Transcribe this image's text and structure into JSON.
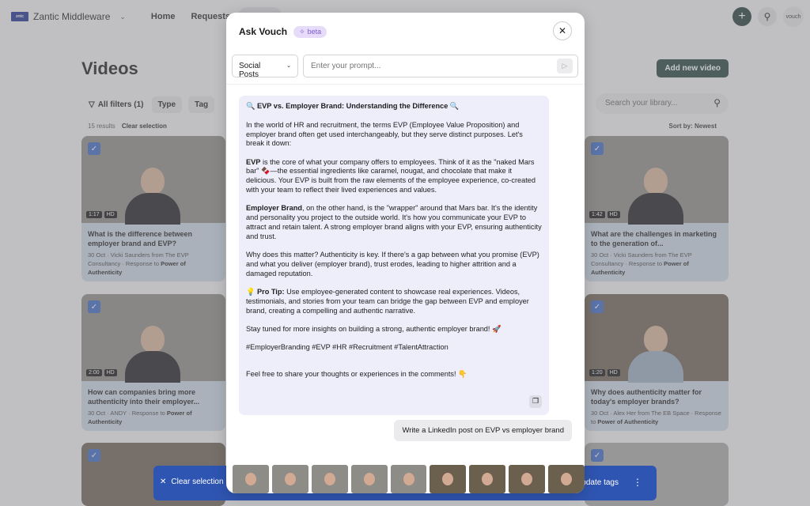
{
  "topbar": {
    "brand_logo_text": "zntc",
    "workspace": "Zantic Middleware",
    "nav": [
      "Home",
      "Requests",
      "Videos"
    ],
    "avatar_text": "vouch"
  },
  "page": {
    "title": "Videos",
    "add_button": "Add new video",
    "filters": {
      "all": "All filters (1)",
      "type": "Type",
      "tag": "Tag"
    },
    "search_placeholder": "Search your library...",
    "results": "15 results",
    "clear_selection": "Clear selection",
    "sort": "Sort by: Newest"
  },
  "cards": [
    {
      "duration": "1:17",
      "quality": "HD",
      "title": "What is the difference between employer brand and EVP?",
      "meta": "30 Oct · Vicki Saunders from The EVP Consultancy · Response to ",
      "response": "Power of Authenticity"
    },
    {
      "duration": "1:42",
      "quality": "HD",
      "title": "What are the challenges in marketing to the generation of...",
      "meta": "30 Oct · Vicki Saunders from The EVP Consultancy · Response to ",
      "response": "Power of Authenticity"
    },
    {
      "duration": "2:00",
      "quality": "HD",
      "title": "How can companies bring more authenticity into their employer...",
      "meta": "30 Oct · ANDY · Response to ",
      "response": "Power of Authenticity"
    },
    {
      "duration": "1:20",
      "quality": "HD",
      "title": "Why does authenticity matter for today's employer brands?",
      "meta": "30 Oct · Alex Her from The EB Space · Response to ",
      "response": "Power of Authenticity"
    }
  ],
  "bulk_bar": {
    "clear": "Clear selection",
    "tags": "Update tags"
  },
  "modal": {
    "title": "Ask Vouch",
    "badge": "beta",
    "type_select": "Social Posts",
    "prompt_placeholder": "Enter your prompt...",
    "response": {
      "heading": "🔍 EVP vs. Employer Brand: Understanding the Difference 🔍",
      "p1": "In the world of HR and recruitment, the terms EVP (Employee Value Proposition) and employer brand often get used interchangeably, but they serve distinct purposes. Let's break it down:",
      "p2_lead": "EVP",
      "p2": " is the core of what your company offers to employees. Think of it as the \"naked Mars bar\" 🍫—the essential ingredients like caramel, nougat, and chocolate that make it delicious. Your EVP is built from the raw elements of the employee experience, co-created with your team to reflect their lived experiences and values.",
      "p3_lead": "Employer Brand",
      "p3": ", on the other hand, is the \"wrapper\" around that Mars bar. It's the identity and personality you project to the outside world. It's how you communicate your EVP to attract and retain talent. A strong employer brand aligns with your EVP, ensuring authenticity and trust.",
      "p4": "Why does this matter? Authenticity is key. If there's a gap between what you promise (EVP) and what you deliver (employer brand), trust erodes, leading to higher attrition and a damaged reputation.",
      "p5_lead": "💡 Pro Tip:",
      "p5": " Use employee-generated content to showcase real experiences. Videos, testimonials, and stories from your team can bridge the gap between EVP and employer brand, creating a compelling and authentic narrative.",
      "p6": "Stay tuned for more insights on building a strong, authentic employer brand! 🚀",
      "p7": "#EmployerBranding #EVP #HR #Recruitment #TalentAttraction",
      "p8": "Feel free to share your thoughts or experiences in the comments! 👇"
    },
    "user_message": "Write a LinkedIn post on EVP vs employer brand"
  }
}
